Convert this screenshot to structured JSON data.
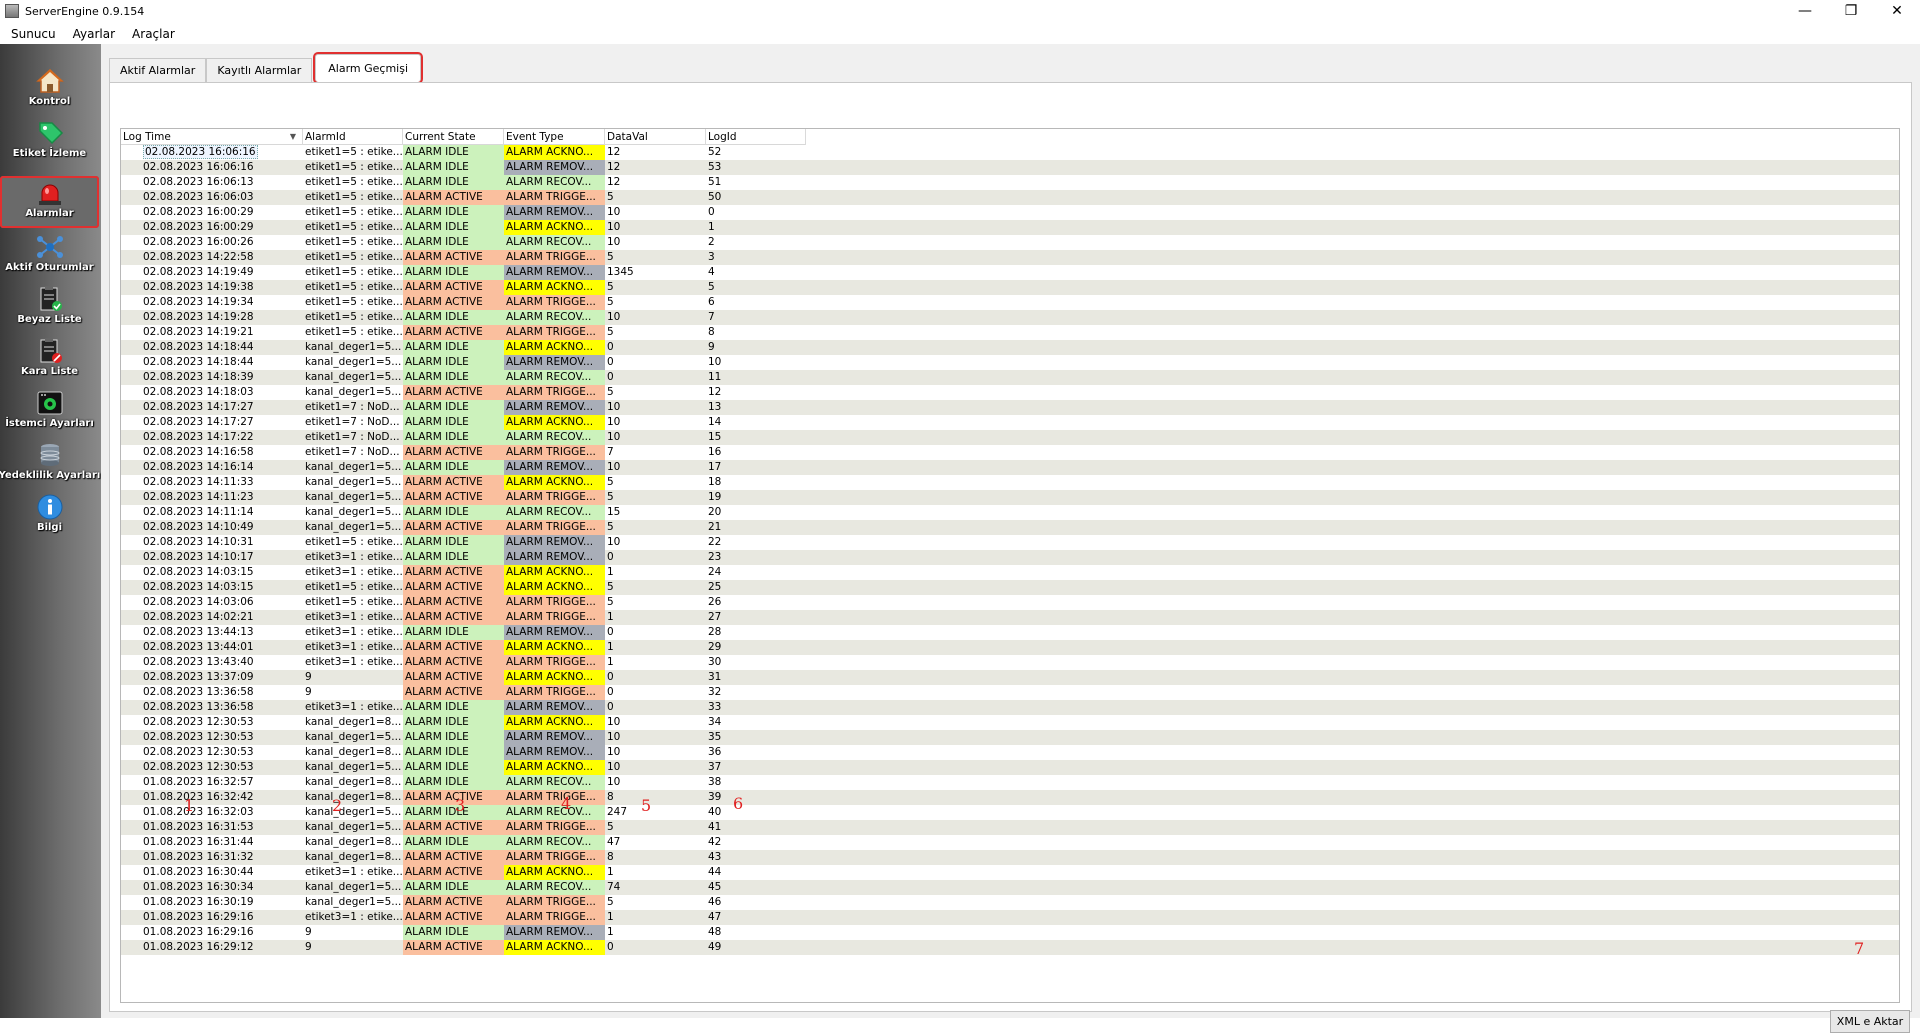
{
  "window": {
    "title": "ServerEngine 0.9.154",
    "minimize": "—",
    "maximize": "❐",
    "close": "✕"
  },
  "menu": [
    "Sunucu",
    "Ayarlar",
    "Araçlar"
  ],
  "sidebar": [
    {
      "label": "Kontrol",
      "icon": "home-icon"
    },
    {
      "label": "Etiket İzleme",
      "icon": "tag-icon"
    },
    {
      "label": "Alarmlar",
      "icon": "alarm-siren-icon",
      "selected": true
    },
    {
      "label": "Aktif Oturumlar",
      "icon": "network-icon"
    },
    {
      "label": "Beyaz Liste",
      "icon": "whitelist-clipboard-icon"
    },
    {
      "label": "Kara Liste",
      "icon": "blacklist-clipboard-icon"
    },
    {
      "label": "İstemci Ayarları",
      "icon": "client-settings-icon"
    },
    {
      "label": "Yedeklilik Ayarları",
      "icon": "database-icon"
    },
    {
      "label": "Bilgi",
      "icon": "info-icon"
    }
  ],
  "tabs": [
    {
      "label": "Aktif Alarmlar"
    },
    {
      "label": "Kayıtlı Alarmlar"
    },
    {
      "label": "Alarm Geçmişi",
      "active": true
    }
  ],
  "table": {
    "columns": [
      "Log Time",
      "AlarmId",
      "Current State",
      "Event Type",
      "DataVal",
      "LogId"
    ],
    "rows": [
      [
        "02.08.2023 16:06:16",
        "etiket1=5 : etike...",
        "ALARM IDLE",
        "ALARM ACKNO...",
        "12",
        "52"
      ],
      [
        "02.08.2023 16:06:16",
        "etiket1=5 : etike...",
        "ALARM IDLE",
        "ALARM REMOV...",
        "12",
        "53"
      ],
      [
        "02.08.2023 16:06:13",
        "etiket1=5 : etike...",
        "ALARM IDLE",
        "ALARM RECOV...",
        "12",
        "51"
      ],
      [
        "02.08.2023 16:06:03",
        "etiket1=5 : etike...",
        "ALARM ACTIVE",
        "ALARM TRIGGE...",
        "5",
        "50"
      ],
      [
        "02.08.2023 16:00:29",
        "etiket1=5 : etike...",
        "ALARM IDLE",
        "ALARM REMOV...",
        "10",
        "0"
      ],
      [
        "02.08.2023 16:00:29",
        "etiket1=5 : etike...",
        "ALARM IDLE",
        "ALARM ACKNO...",
        "10",
        "1"
      ],
      [
        "02.08.2023 16:00:26",
        "etiket1=5 : etike...",
        "ALARM IDLE",
        "ALARM RECOV...",
        "10",
        "2"
      ],
      [
        "02.08.2023 14:22:58",
        "etiket1=5 : etike...",
        "ALARM ACTIVE",
        "ALARM TRIGGE...",
        "5",
        "3"
      ],
      [
        "02.08.2023 14:19:49",
        "etiket1=5 : etike...",
        "ALARM IDLE",
        "ALARM REMOV...",
        "1345",
        "4"
      ],
      [
        "02.08.2023 14:19:38",
        "etiket1=5 : etike...",
        "ALARM ACTIVE",
        "ALARM ACKNO...",
        "5",
        "5"
      ],
      [
        "02.08.2023 14:19:34",
        "etiket1=5 : etike...",
        "ALARM ACTIVE",
        "ALARM TRIGGE...",
        "5",
        "6"
      ],
      [
        "02.08.2023 14:19:28",
        "etiket1=5 : etike...",
        "ALARM IDLE",
        "ALARM RECOV...",
        "10",
        "7"
      ],
      [
        "02.08.2023 14:19:21",
        "etiket1=5 : etike...",
        "ALARM ACTIVE",
        "ALARM TRIGGE...",
        "5",
        "8"
      ],
      [
        "02.08.2023 14:18:44",
        "kanal_deger1=5...",
        "ALARM IDLE",
        "ALARM ACKNO...",
        "0",
        "9"
      ],
      [
        "02.08.2023 14:18:44",
        "kanal_deger1=5...",
        "ALARM IDLE",
        "ALARM REMOV...",
        "0",
        "10"
      ],
      [
        "02.08.2023 14:18:39",
        "kanal_deger1=5...",
        "ALARM IDLE",
        "ALARM RECOV...",
        "0",
        "11"
      ],
      [
        "02.08.2023 14:18:03",
        "kanal_deger1=5...",
        "ALARM ACTIVE",
        "ALARM TRIGGE...",
        "5",
        "12"
      ],
      [
        "02.08.2023 14:17:27",
        "etiket1=7 : NoD...",
        "ALARM IDLE",
        "ALARM REMOV...",
        "10",
        "13"
      ],
      [
        "02.08.2023 14:17:27",
        "etiket1=7 : NoD...",
        "ALARM IDLE",
        "ALARM ACKNO...",
        "10",
        "14"
      ],
      [
        "02.08.2023 14:17:22",
        "etiket1=7 : NoD...",
        "ALARM IDLE",
        "ALARM RECOV...",
        "10",
        "15"
      ],
      [
        "02.08.2023 14:16:58",
        "etiket1=7 : NoD...",
        "ALARM ACTIVE",
        "ALARM TRIGGE...",
        "7",
        "16"
      ],
      [
        "02.08.2023 14:16:14",
        "kanal_deger1=5...",
        "ALARM IDLE",
        "ALARM REMOV...",
        "10",
        "17"
      ],
      [
        "02.08.2023 14:11:33",
        "kanal_deger1=5...",
        "ALARM ACTIVE",
        "ALARM ACKNO...",
        "5",
        "18"
      ],
      [
        "02.08.2023 14:11:23",
        "kanal_deger1=5...",
        "ALARM ACTIVE",
        "ALARM TRIGGE...",
        "5",
        "19"
      ],
      [
        "02.08.2023 14:11:14",
        "kanal_deger1=5...",
        "ALARM IDLE",
        "ALARM RECOV...",
        "15",
        "20"
      ],
      [
        "02.08.2023 14:10:49",
        "kanal_deger1=5...",
        "ALARM ACTIVE",
        "ALARM TRIGGE...",
        "5",
        "21"
      ],
      [
        "02.08.2023 14:10:31",
        "etiket1=5 : etike...",
        "ALARM IDLE",
        "ALARM REMOV...",
        "10",
        "22"
      ],
      [
        "02.08.2023 14:10:17",
        "etiket3=1 : etike...",
        "ALARM IDLE",
        "ALARM REMOV...",
        "0",
        "23"
      ],
      [
        "02.08.2023 14:03:15",
        "etiket3=1 : etike...",
        "ALARM ACTIVE",
        "ALARM ACKNO...",
        "1",
        "24"
      ],
      [
        "02.08.2023 14:03:15",
        "etiket1=5 : etike...",
        "ALARM ACTIVE",
        "ALARM ACKNO...",
        "5",
        "25"
      ],
      [
        "02.08.2023 14:03:06",
        "etiket1=5 : etike...",
        "ALARM ACTIVE",
        "ALARM TRIGGE...",
        "5",
        "26"
      ],
      [
        "02.08.2023 14:02:21",
        "etiket3=1 : etike...",
        "ALARM ACTIVE",
        "ALARM TRIGGE...",
        "1",
        "27"
      ],
      [
        "02.08.2023 13:44:13",
        "etiket3=1 : etike...",
        "ALARM IDLE",
        "ALARM REMOV...",
        "0",
        "28"
      ],
      [
        "02.08.2023 13:44:01",
        "etiket3=1 : etike...",
        "ALARM ACTIVE",
        "ALARM ACKNO...",
        "1",
        "29"
      ],
      [
        "02.08.2023 13:43:40",
        "etiket3=1 : etike...",
        "ALARM ACTIVE",
        "ALARM TRIGGE...",
        "1",
        "30"
      ],
      [
        "02.08.2023 13:37:09",
        "9",
        "ALARM ACTIVE",
        "ALARM ACKNO...",
        "0",
        "31"
      ],
      [
        "02.08.2023 13:36:58",
        "9",
        "ALARM ACTIVE",
        "ALARM TRIGGE...",
        "0",
        "32"
      ],
      [
        "02.08.2023 13:36:58",
        "etiket3=1 : etike...",
        "ALARM IDLE",
        "ALARM REMOV...",
        "0",
        "33"
      ],
      [
        "02.08.2023 12:30:53",
        "kanal_deger1=8...",
        "ALARM IDLE",
        "ALARM ACKNO...",
        "10",
        "34"
      ],
      [
        "02.08.2023 12:30:53",
        "kanal_deger1=5...",
        "ALARM IDLE",
        "ALARM REMOV...",
        "10",
        "35"
      ],
      [
        "02.08.2023 12:30:53",
        "kanal_deger1=8...",
        "ALARM IDLE",
        "ALARM REMOV...",
        "10",
        "36"
      ],
      [
        "02.08.2023 12:30:53",
        "kanal_deger1=5...",
        "ALARM IDLE",
        "ALARM ACKNO...",
        "10",
        "37"
      ],
      [
        "01.08.2023 16:32:57",
        "kanal_deger1=8...",
        "ALARM IDLE",
        "ALARM RECOV...",
        "10",
        "38"
      ],
      [
        "01.08.2023 16:32:42",
        "kanal_deger1=8...",
        "ALARM ACTIVE",
        "ALARM TRIGGE...",
        "8",
        "39"
      ],
      [
        "01.08.2023 16:32:03",
        "kanal_deger1=5...",
        "ALARM IDLE",
        "ALARM RECOV...",
        "247",
        "40"
      ],
      [
        "01.08.2023 16:31:53",
        "kanal_deger1=5...",
        "ALARM ACTIVE",
        "ALARM TRIGGE...",
        "5",
        "41"
      ],
      [
        "01.08.2023 16:31:44",
        "kanal_deger1=8...",
        "ALARM IDLE",
        "ALARM RECOV...",
        "47",
        "42"
      ],
      [
        "01.08.2023 16:31:32",
        "kanal_deger1=8...",
        "ALARM ACTIVE",
        "ALARM TRIGGE...",
        "8",
        "43"
      ],
      [
        "01.08.2023 16:30:44",
        "etiket3=1 : etike...",
        "ALARM ACTIVE",
        "ALARM ACKNO...",
        "1",
        "44"
      ],
      [
        "01.08.2023 16:30:34",
        "kanal_deger1=5...",
        "ALARM IDLE",
        "ALARM RECOV...",
        "74",
        "45"
      ],
      [
        "01.08.2023 16:30:19",
        "kanal_deger1=5...",
        "ALARM ACTIVE",
        "ALARM TRIGGE...",
        "5",
        "46"
      ],
      [
        "01.08.2023 16:29:16",
        "etiket3=1 : etike...",
        "ALARM ACTIVE",
        "ALARM TRIGGE...",
        "1",
        "47"
      ],
      [
        "01.08.2023 16:29:16",
        "9",
        "ALARM IDLE",
        "ALARM REMOV...",
        "1",
        "48"
      ],
      [
        "01.08.2023 16:29:12",
        "9",
        "ALARM ACTIVE",
        "ALARM ACKNO...",
        "0",
        "49"
      ]
    ]
  },
  "annotations": [
    "1",
    "2",
    "3",
    "4",
    "5",
    "6",
    "7"
  ],
  "export_button": "XML e Aktar",
  "colors": {
    "idle": "#ccf2bc",
    "active": "#fabf9e",
    "acknowledge": "#ffff00",
    "remove": "#a9aeb8",
    "trigger": "#fabf9e",
    "recover": "#ccf2bc",
    "highlight": "#e03030"
  }
}
